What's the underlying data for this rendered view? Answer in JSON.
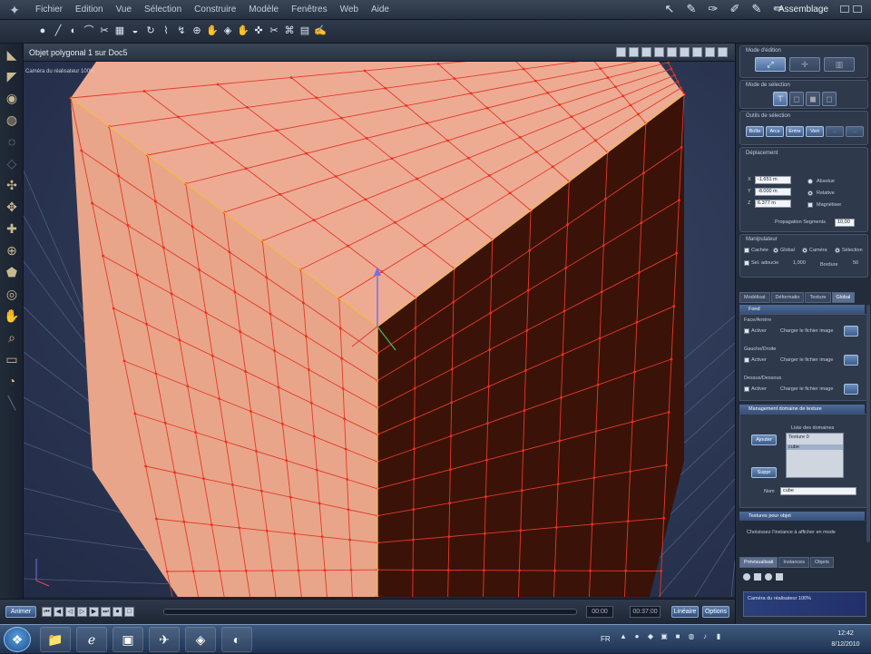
{
  "menubar": {
    "logo_glyph": "✦",
    "items": [
      "Fichier",
      "Edition",
      "Vue",
      "Sélection",
      "Construire",
      "Modèle",
      "Fenêtres",
      "Web",
      "Aide"
    ],
    "tool_glyphs": [
      "↖",
      "✎",
      "✑",
      "✐",
      "✎",
      "✏"
    ],
    "mode_label": "Assemblage"
  },
  "toolbar": {
    "glyphs": [
      "●",
      "╱",
      "◐",
      "⌒",
      "✂",
      "▦",
      "◒",
      "↻",
      "⌇",
      "↯",
      "⊕",
      "✋",
      "◈",
      "✋",
      "✜",
      "✂",
      "⌘",
      "▤",
      "✍"
    ]
  },
  "leftbar": {
    "glyphs": [
      "◣",
      "◤",
      "◉",
      "◍",
      "◌",
      "◇",
      "✣",
      "✥",
      "✚",
      "⊕",
      "⬟",
      "◎",
      "✋",
      "⌕",
      "▭",
      "◔",
      "╲"
    ]
  },
  "viewport": {
    "title": "Objet polygonal 1 sur Doc5",
    "camera_label": "Caméra du réalisateur 100%"
  },
  "timeline": {
    "anim_button": "Animer",
    "transport": [
      "⏮",
      "◀",
      "◁",
      "▷",
      "▶",
      "⏭",
      "⏺",
      "□"
    ],
    "time_current": "00:00",
    "time_end": "00:37:00",
    "speed_label": "Linéaire",
    "options_label": "Options"
  },
  "panel": {
    "edit_mode": {
      "title": "Mode d'édition",
      "buttons": [
        "⤢",
        "✛",
        "▥"
      ]
    },
    "selection_mode": {
      "title": "Mode de sélection",
      "buttons": [
        "⊤",
        "◻",
        "◼",
        "◻"
      ]
    },
    "selection_tools": {
      "title": "Outils de sélection",
      "buttons": [
        "Boîte",
        "Arcs",
        "Entre",
        "Vert",
        "...",
        "..."
      ]
    },
    "move": {
      "title": "Déplacement",
      "x_label": "X",
      "y_label": "Y",
      "z_label": "Z",
      "x_value": "-1.651 m",
      "y_value": "-8.000 m",
      "z_value": "6.377 m",
      "absolute": "Absolue",
      "relative": "Relative",
      "magnet": "Magnétiser",
      "propagation_label": "Propagation Segments",
      "propagation_value": "10,00"
    },
    "manipulator": {
      "title": "Manipulateur",
      "hidden": "Cachée",
      "global": "Global",
      "camera": "Caméra",
      "selection": "Sélection",
      "sel_area": "Sel. adoucie",
      "sel_value": "1,000",
      "border": "Bordure",
      "border_value": "50"
    },
    "tabs": [
      "Modélisat",
      "Déformatio",
      "Texture",
      "Global"
    ],
    "fond": {
      "header": "Fond",
      "face_label": "Face/Arrière",
      "gauche_label": "Gauche/Droite",
      "dessus_label": "Dessus/Dessous",
      "active": "Activer",
      "load_image": "Charger le fichier image"
    },
    "texture_domain": {
      "header": "Management domaine de texture",
      "list_title": "Liste des domaines",
      "add": "Ajouter",
      "remove": "Suppr",
      "items": [
        "Texture 0",
        "cube"
      ],
      "name_label": "Nom",
      "name_value": "cube"
    },
    "textures_objet": {
      "header": "Textures pour objet",
      "hint": "Choisissez l'instance à afficher en mode"
    },
    "bottom_tabs": [
      "Prévisualisati",
      "Instances",
      "Objets"
    ],
    "preview_label": "Caméra du réalisateur 100%"
  },
  "taskbar": {
    "start_glyph": "❖",
    "apps": [
      "📁",
      "ℯ",
      "▣",
      "✈",
      "◈",
      "◐"
    ],
    "lang": "FR",
    "tray": [
      "▲",
      "●",
      "◆",
      "▣",
      "■",
      "◍",
      "♪",
      "▮"
    ],
    "time": "12:42",
    "date": "8/12/2010"
  }
}
